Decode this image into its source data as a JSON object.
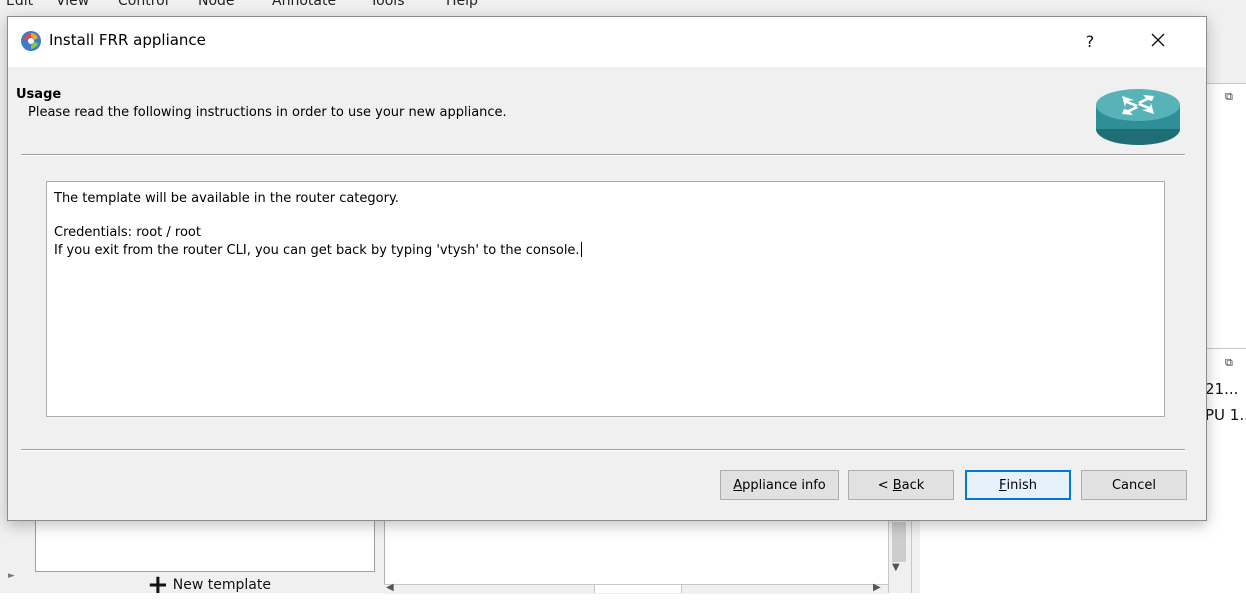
{
  "background": {
    "menu": [
      "Edit",
      "View",
      "Control",
      "Node",
      "Annotate",
      "Tools",
      "Help"
    ],
    "dock_texts": [
      "21...",
      "PU 1.."
    ],
    "new_template_label": "New template"
  },
  "dialog": {
    "title": "Install FRR appliance",
    "help_label": "?",
    "close_label": "✕",
    "header": {
      "title": "Usage",
      "subtitle": "Please read the following instructions in order to use your new appliance."
    },
    "instructions": {
      "line1": "The template will be available in the router category.",
      "line2": "Credentials: root / root",
      "line3": "If you exit from the router CLI, you can get back by typing 'vtysh' to the console."
    },
    "buttons": {
      "info": "Appliance info",
      "info_mnemonic": "A",
      "info_rest": "ppliance info",
      "back_prefix": "< ",
      "back_mnemonic": "B",
      "back_rest": "ack",
      "finish_mnemonic": "F",
      "finish_rest": "inish",
      "cancel": "Cancel"
    }
  },
  "colors": {
    "accent": "#0078d7",
    "router_teal": "#2f8f96"
  }
}
